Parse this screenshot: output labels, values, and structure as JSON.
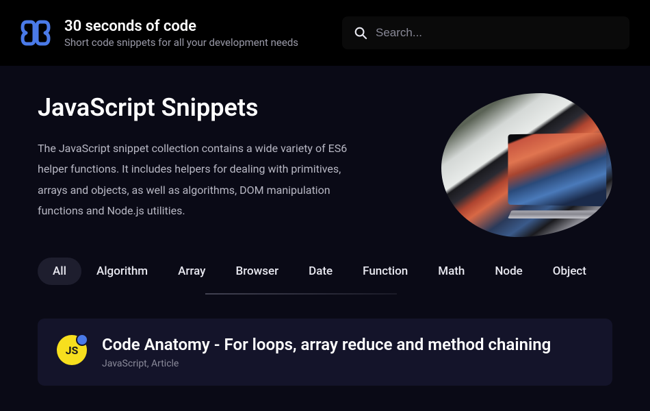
{
  "brand": {
    "title": "30 seconds of code",
    "subtitle": "Short code snippets for all your development needs"
  },
  "search": {
    "placeholder": "Search..."
  },
  "hero": {
    "title": "JavaScript Snippets",
    "description": "The JavaScript snippet collection contains a wide variety of ES6 helper functions. It includes helpers for dealing with primitives, arrays and objects, as well as algorithms, DOM manipulation functions and Node.js utilities."
  },
  "tabs": [
    {
      "label": "All",
      "active": true
    },
    {
      "label": "Algorithm",
      "active": false
    },
    {
      "label": "Array",
      "active": false
    },
    {
      "label": "Browser",
      "active": false
    },
    {
      "label": "Date",
      "active": false
    },
    {
      "label": "Function",
      "active": false
    },
    {
      "label": "Math",
      "active": false
    },
    {
      "label": "Node",
      "active": false
    },
    {
      "label": "Object",
      "active": false
    }
  ],
  "card": {
    "icon_text": "JS",
    "title": "Code Anatomy - For loops, array reduce and method chaining",
    "meta": "JavaScript, Article"
  }
}
